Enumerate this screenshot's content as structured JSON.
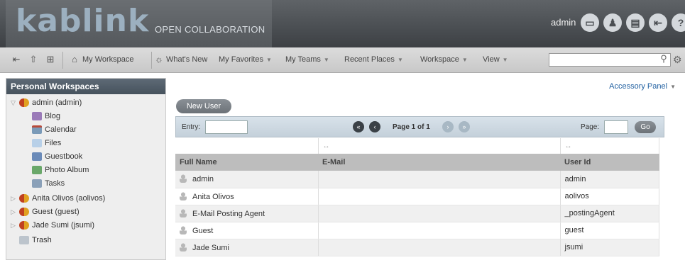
{
  "header": {
    "logo": "kablink",
    "tagline": "OPEN COLLABORATION",
    "user": "admin",
    "icons": [
      "monitor-icon",
      "user-edit-icon",
      "notes-icon",
      "logout-icon",
      "help-icon"
    ],
    "help_glyph": "?"
  },
  "toolbar": {
    "my_workspace": "My Workspace",
    "whats_new": "What's New",
    "my_favorites": "My Favorites",
    "my_teams": "My Teams",
    "recent_places": "Recent Places",
    "workspace": "Workspace",
    "view": "View",
    "search_placeholder": ""
  },
  "sidebar": {
    "title": "Personal Workspaces",
    "items": [
      {
        "label": "admin (admin)",
        "icon": "user-workspace-icon"
      },
      {
        "label": "Blog",
        "icon": "blog-icon"
      },
      {
        "label": "Calendar",
        "icon": "calendar-icon"
      },
      {
        "label": "Files",
        "icon": "files-icon"
      },
      {
        "label": "Guestbook",
        "icon": "guestbook-icon"
      },
      {
        "label": "Photo Album",
        "icon": "photo-album-icon"
      },
      {
        "label": "Tasks",
        "icon": "tasks-icon"
      },
      {
        "label": "Anita Olivos (aolivos)",
        "icon": "user-workspace-icon"
      },
      {
        "label": "Guest (guest)",
        "icon": "user-workspace-icon"
      },
      {
        "label": "Jade Sumi (jsumi)",
        "icon": "user-workspace-icon"
      },
      {
        "label": "Trash",
        "icon": "trash-icon"
      }
    ]
  },
  "main": {
    "accessory_panel": "Accessory Panel",
    "new_user": "New User",
    "pager": {
      "entry_label": "Entry:",
      "page_text": "Page 1 of 1",
      "page_label": "Page:",
      "go": "Go"
    },
    "resize_hint": "↔",
    "columns": [
      "Full Name",
      "E-Mail",
      "User Id"
    ],
    "rows": [
      {
        "name": "admin",
        "email": "",
        "userid": "admin"
      },
      {
        "name": "Anita Olivos",
        "email": "",
        "userid": "aolivos"
      },
      {
        "name": "E-Mail Posting Agent",
        "email": "",
        "userid": "_postingAgent"
      },
      {
        "name": "Guest",
        "email": "",
        "userid": "guest"
      },
      {
        "name": "Jade Sumi",
        "email": "",
        "userid": "jsumi"
      }
    ]
  },
  "colors": {
    "header_bg": "#4a4e52",
    "logo": "#9cb0c0",
    "link": "#1f5fa0",
    "sidebar_head": "#46525d"
  }
}
